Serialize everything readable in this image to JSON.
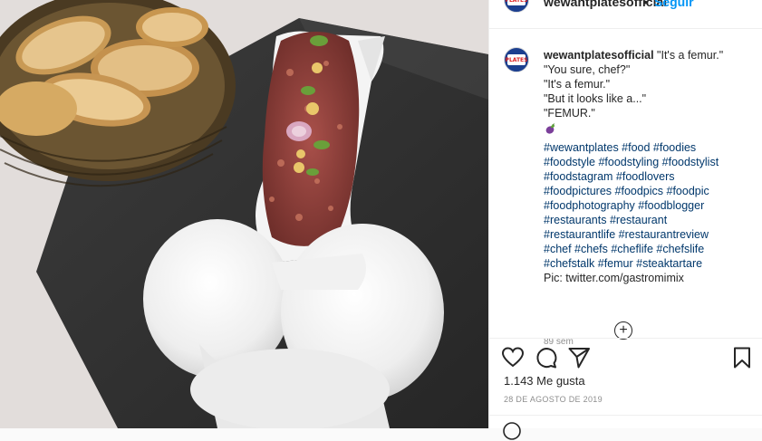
{
  "post": {
    "username": "wewantplatesofficial",
    "follow_label": "Seguir",
    "more_label": "···",
    "avatar_text": "PLATES",
    "caption_first": "\"It's a femur.\"",
    "caption_lines": [
      "\"You sure, chef?\"",
      "\"It's a femur.\"",
      "\"But it looks like a...\"",
      "\"FEMUR.\""
    ],
    "hashtag_lines": [
      "#wewantplates #food #foodies",
      "#foodstyle #foodstyling #foodstylist",
      "#foodstagram #foodlovers",
      "#foodpictures #foodpics #foodpic",
      "#foodphotography #foodblogger",
      "#restaurants #restaurant",
      "#restaurantlife #restaurantreview",
      "#chef #chefs #cheflife #chefslife",
      "#chefstalk #femur #steaktartare"
    ],
    "credit": "Pic: twitter.com/gastromimix",
    "time_ago": "89 sem",
    "load_more": "+",
    "likes": "1.143 Me gusta",
    "date": "28 DE AGOSTO DE 2019"
  },
  "icons": {
    "like": "heart-icon",
    "comment": "comment-bubble-icon",
    "share": "paper-plane-icon",
    "save": "bookmark-icon",
    "emoji": "eggplant-emoji-icon"
  },
  "colors": {
    "link": "#00376b",
    "follow": "#0095f6",
    "secondary": "#8e8e8e",
    "text": "#262626"
  }
}
